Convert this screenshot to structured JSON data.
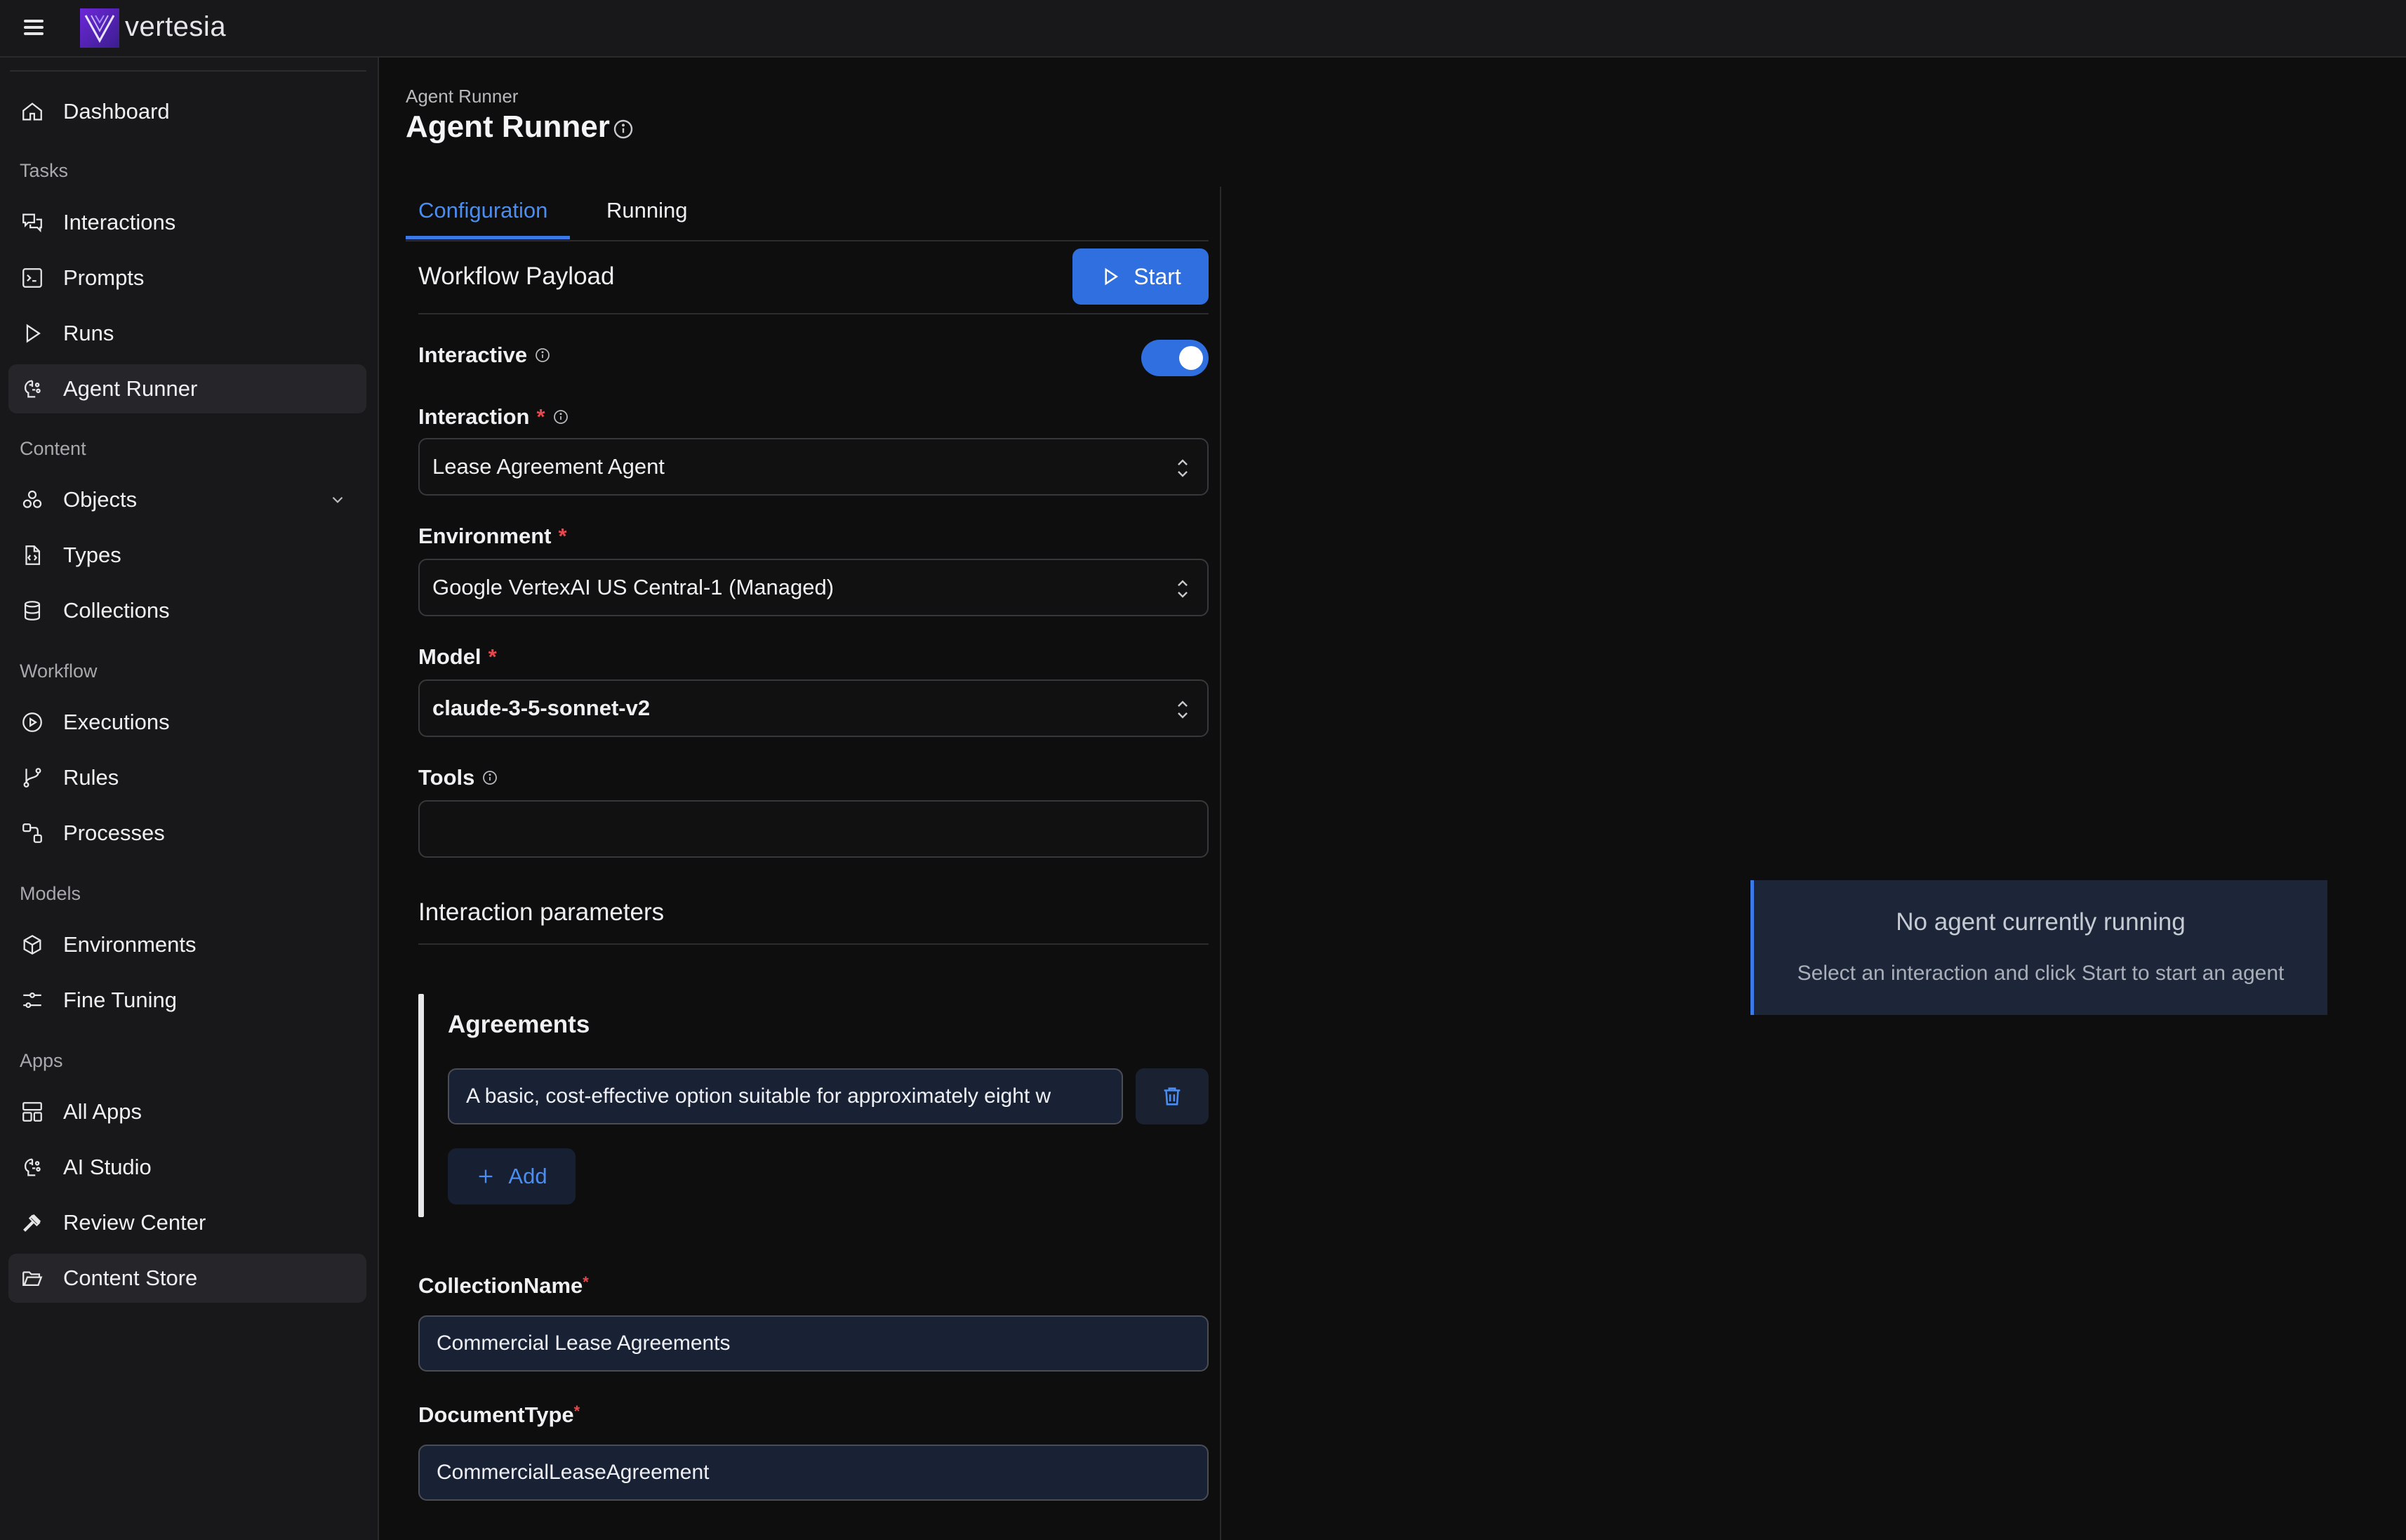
{
  "app": {
    "brand": "vertesia",
    "accent": "#2f6fe0"
  },
  "sidebar": {
    "items": [
      {
        "label": "Dashboard",
        "icon": "home-icon"
      },
      {
        "label": "Interactions",
        "icon": "chat-icon"
      },
      {
        "label": "Prompts",
        "icon": "prompt-icon"
      },
      {
        "label": "Runs",
        "icon": "play-icon"
      },
      {
        "label": "Agent Runner",
        "icon": "brain-icon"
      },
      {
        "label": "Objects",
        "icon": "objects-icon"
      },
      {
        "label": "Types",
        "icon": "file-code-icon"
      },
      {
        "label": "Collections",
        "icon": "database-icon"
      },
      {
        "label": "Executions",
        "icon": "play-circle-icon"
      },
      {
        "label": "Rules",
        "icon": "git-branch-icon"
      },
      {
        "label": "Processes",
        "icon": "workflow-icon"
      },
      {
        "label": "Environments",
        "icon": "box-icon"
      },
      {
        "label": "Fine Tuning",
        "icon": "sliders-icon"
      },
      {
        "label": "All Apps",
        "icon": "layout-icon"
      },
      {
        "label": "AI Studio",
        "icon": "brain-icon"
      },
      {
        "label": "Review Center",
        "icon": "gavel-icon"
      },
      {
        "label": "Content Store",
        "icon": "folder-open-icon"
      }
    ],
    "sections": [
      "Tasks",
      "Content",
      "Workflow",
      "Models",
      "Apps"
    ]
  },
  "page": {
    "breadcrumb": "Agent Runner",
    "title": "Agent Runner"
  },
  "tabs": {
    "configuration": "Configuration",
    "running": "Running"
  },
  "payload": {
    "title": "Workflow Payload",
    "start_label": "Start",
    "interactive_label": "Interactive",
    "interactive_on": true,
    "interaction_label": "Interaction",
    "interaction_value": "Lease Agreement Agent",
    "environment_label": "Environment",
    "environment_value": "Google VertexAI US Central-1 (Managed)",
    "model_label": "Model",
    "model_value": "claude-3-5-sonnet-v2",
    "tools_label": "Tools",
    "tools_value": "",
    "required_mark": "*"
  },
  "params": {
    "title": "Interaction parameters",
    "agreements_title": "Agreements",
    "agreement_value": "A basic, cost-effective option suitable for approximately eight w",
    "add_label": "Add",
    "collection_label": "CollectionName",
    "collection_value": "Commercial Lease Agreements",
    "doctype_label": "DocumentType",
    "doctype_value": "CommercialLeaseAgreement"
  },
  "status": {
    "title": "No agent currently running",
    "subtitle": "Select an interaction and click Start to start an agent"
  }
}
